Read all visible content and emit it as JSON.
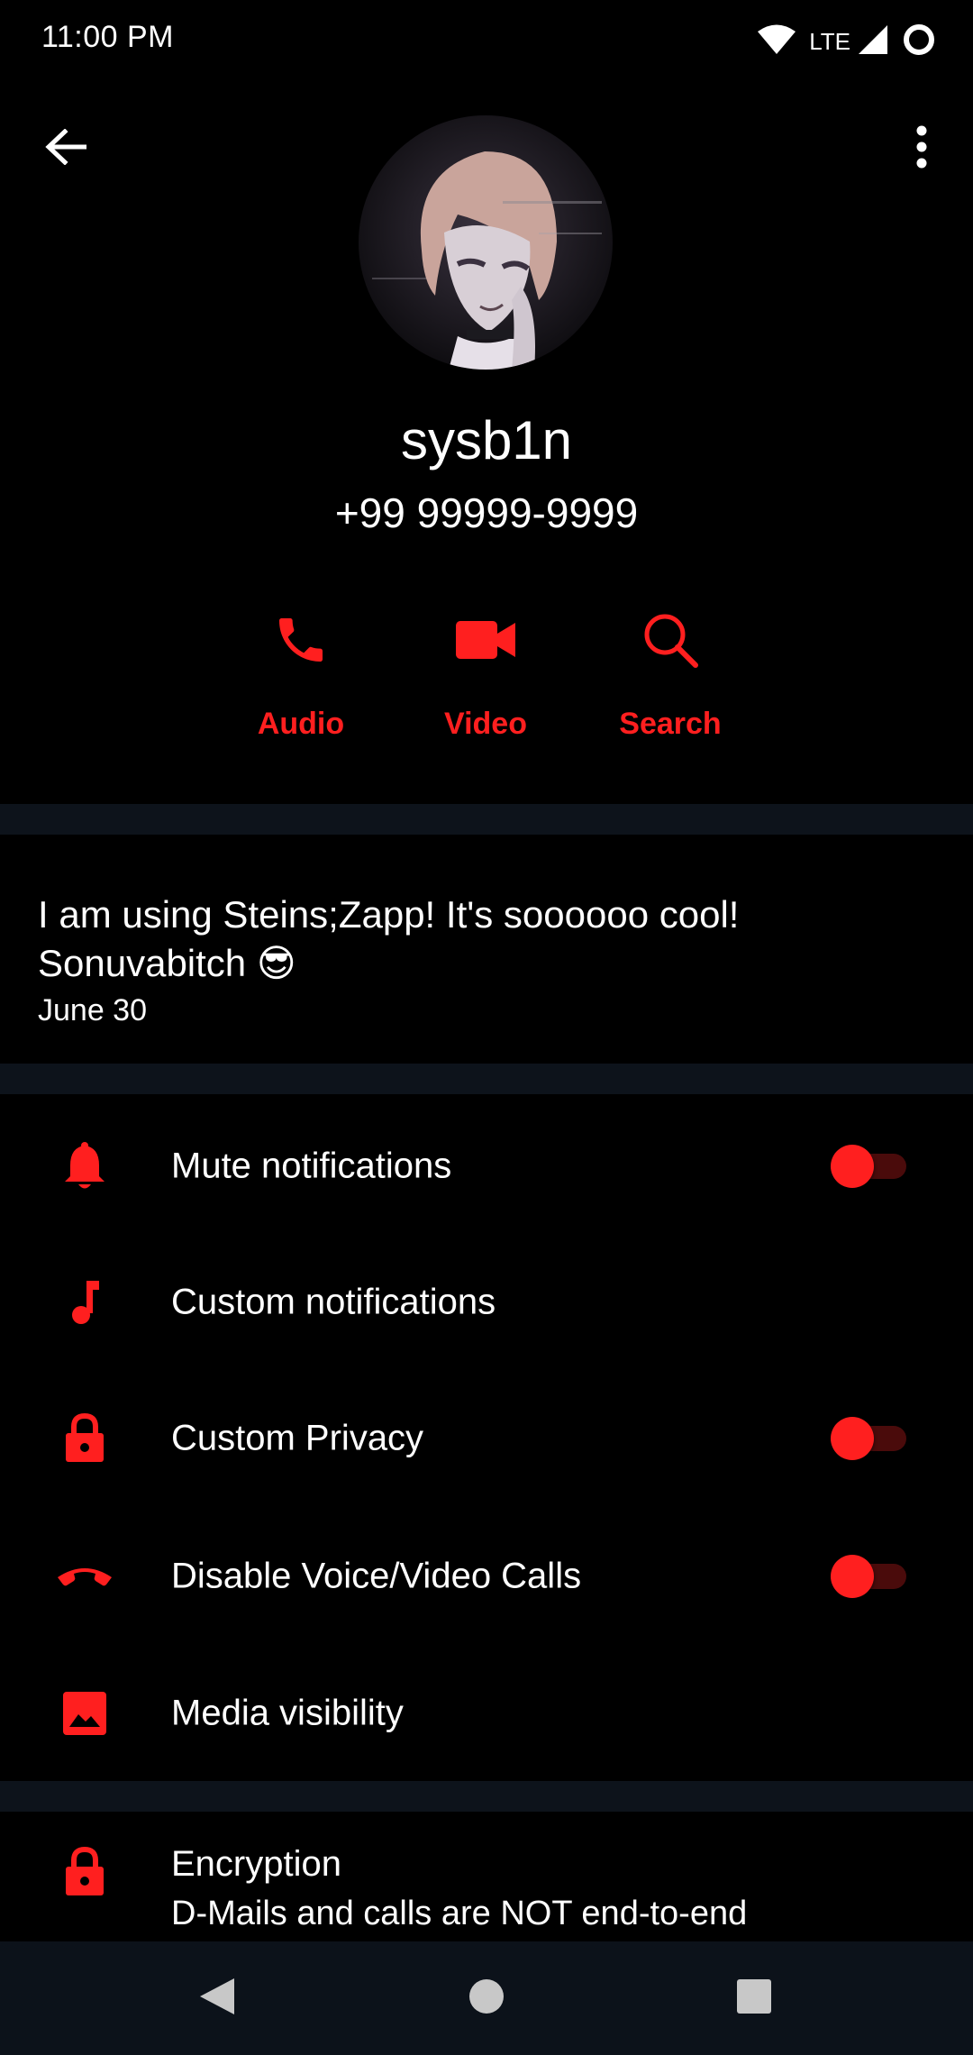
{
  "status_bar": {
    "time": "11:00 PM",
    "network": "LTE",
    "icons": [
      "wifi-icon",
      "signal-icon",
      "battery-ring-icon"
    ]
  },
  "header": {
    "back_icon": "arrow-left-icon",
    "menu_icon": "more-vertical-icon",
    "name": "sysb1n",
    "phone": "+99 99999-9999",
    "actions": [
      {
        "label": "Audio",
        "icon": "phone-icon"
      },
      {
        "label": "Video",
        "icon": "video-camera-icon"
      },
      {
        "label": "Search",
        "icon": "search-icon"
      }
    ]
  },
  "about": {
    "line1": "I am using Steins;Zapp! It's soooooo cool!",
    "line2": "Sonuvabitch 😎",
    "date": "June 30"
  },
  "settings": [
    {
      "label": "Mute notifications",
      "icon": "bell-icon",
      "has_toggle": true,
      "on": false
    },
    {
      "label": "Custom notifications",
      "icon": "music-note-icon",
      "has_toggle": false
    },
    {
      "label": "Custom Privacy",
      "icon": "lock-icon",
      "has_toggle": true,
      "on": false
    },
    {
      "label": "Disable Voice/Video Calls",
      "icon": "hangup-phone-icon",
      "has_toggle": true,
      "on": false
    },
    {
      "label": "Media visibility",
      "icon": "image-icon",
      "has_toggle": false
    }
  ],
  "encryption": {
    "title": "Encryption",
    "subtitle": "D-Mails and calls are NOT end-to-end"
  },
  "nav_bar": {
    "buttons": [
      "back-triangle-icon",
      "home-circle-icon",
      "recents-square-icon"
    ]
  },
  "colors": {
    "accent": "#ff1f1f",
    "background": "#000000",
    "divider": "#0d131b",
    "nav_bar": "#0c121a",
    "toggle_track": "#4a0b0b"
  }
}
